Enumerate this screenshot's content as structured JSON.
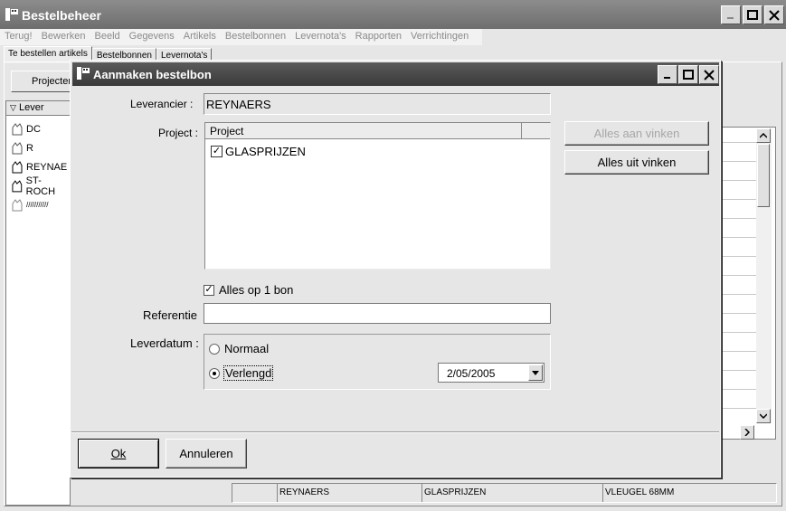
{
  "window": {
    "title": "Bestelbeheer",
    "menu": [
      "Terug!",
      "Bewerken",
      "Beeld",
      "Gegevens",
      "Artikels",
      "Bestelbonnen",
      "Levernota's",
      "Rapporten",
      "Verrichtingen"
    ],
    "tabs": [
      "Te bestellen artikels",
      "Bestelbonnen",
      "Levernota's"
    ]
  },
  "background": {
    "projects_button_label": "Projecten",
    "list_header": "Lever",
    "list_items": [
      "DC",
      "R",
      "REYNAE",
      "ST-ROCH",
      "///////////"
    ],
    "status_row": [
      "",
      "REYNAERS",
      "GLASPRIJZEN",
      "VLEUGEL 68MM"
    ]
  },
  "dialog": {
    "title": "Aanmaken bestelbon",
    "supplier_label": "Leverancier :",
    "supplier_value": "REYNAERS",
    "project_label": "Project :",
    "project_column_header": "Project",
    "projects": [
      {
        "name": "GLASPRIJZEN",
        "checked": true
      }
    ],
    "check_all_label": "Alles aan vinken",
    "uncheck_all_label": "Alles uit vinken",
    "all_on_one_label": "Alles op 1 bon",
    "all_on_one_checked": true,
    "reference_label": "Referentie",
    "reference_value": "",
    "delivery_label": "Leverdatum :",
    "delivery_normal_label": "Normaal",
    "delivery_extended_label": "Verlengd",
    "delivery_selected": "Verlengd",
    "delivery_date": "2/05/2005",
    "ok_label": "Ok",
    "cancel_label": "Annuleren"
  }
}
